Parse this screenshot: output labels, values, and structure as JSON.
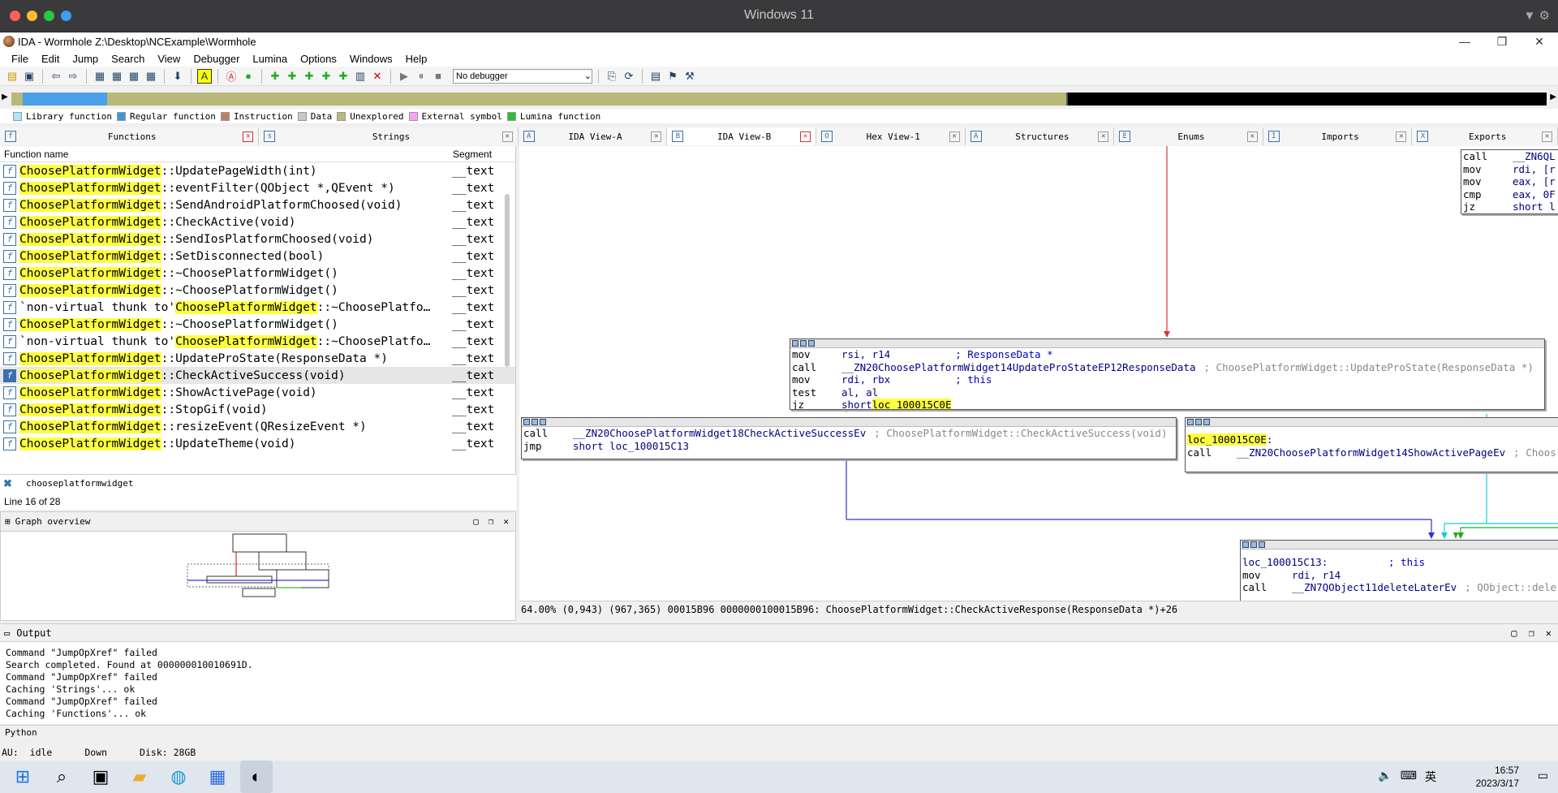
{
  "os_title": "Windows 11",
  "window": {
    "title": "IDA - Wormhole Z:\\Desktop\\NCExample\\Wormhole",
    "min": "—",
    "max": "❐",
    "close": "✕"
  },
  "menu": [
    "File",
    "Edit",
    "Jump",
    "Search",
    "View",
    "Debugger",
    "Lumina",
    "Options",
    "Windows",
    "Help"
  ],
  "debugger_select": "No debugger",
  "legend": [
    {
      "label": "Library function",
      "color": "#a8e8f8"
    },
    {
      "label": "Regular function",
      "color": "#3a9ad9"
    },
    {
      "label": "Instruction",
      "color": "#c08060"
    },
    {
      "label": "Data",
      "color": "#c8c8c8"
    },
    {
      "label": "Unexplored",
      "color": "#b8b878"
    },
    {
      "label": "External symbol",
      "color": "#f8a0f8"
    },
    {
      "label": "Lumina function",
      "color": "#30c030"
    }
  ],
  "tabs": [
    {
      "label": "Functions",
      "icon": "f",
      "close_red": true,
      "active": false
    },
    {
      "label": "Strings",
      "icon": "s",
      "close_red": false,
      "active": false
    },
    {
      "label": "IDA View-A",
      "icon": "A",
      "close_red": false,
      "active": false
    },
    {
      "label": "IDA View-B",
      "icon": "B",
      "close_red": true,
      "active": true
    },
    {
      "label": "Hex View-1",
      "icon": "O",
      "close_red": false,
      "active": false
    },
    {
      "label": "Structures",
      "icon": "A",
      "close_red": false,
      "active": false
    },
    {
      "label": "Enums",
      "icon": "E",
      "close_red": false,
      "active": false
    },
    {
      "label": "Imports",
      "icon": "I",
      "close_red": false,
      "active": false
    },
    {
      "label": "Exports",
      "icon": "X",
      "close_red": false,
      "active": false
    }
  ],
  "functions": {
    "col_name": "Function name",
    "col_segment": "Segment",
    "rows": [
      {
        "pre": "",
        "hl": "ChoosePlatformWidget",
        "post": "::UpdatePageWidth(int)",
        "seg": "__text"
      },
      {
        "pre": "",
        "hl": "ChoosePlatformWidget",
        "post": "::eventFilter(QObject *,QEvent *)",
        "seg": "__text"
      },
      {
        "pre": "",
        "hl": "ChoosePlatformWidget",
        "post": "::SendAndroidPlatformChoosed(void)",
        "seg": "__text"
      },
      {
        "pre": "",
        "hl": "ChoosePlatformWidget",
        "post": "::CheckActive(void)",
        "seg": "__text"
      },
      {
        "pre": "",
        "hl": "ChoosePlatformWidget",
        "post": "::SendIosPlatformChoosed(void)",
        "seg": "__text"
      },
      {
        "pre": "",
        "hl": "ChoosePlatformWidget",
        "post": "::SetDisconnected(bool)",
        "seg": "__text"
      },
      {
        "pre": "",
        "hl": "ChoosePlatformWidget",
        "post": "::~ChoosePlatformWidget()",
        "seg": "__text"
      },
      {
        "pre": "",
        "hl": "ChoosePlatformWidget",
        "post": "::~ChoosePlatformWidget()",
        "seg": "__text"
      },
      {
        "pre": "`non-virtual thunk to'",
        "hl": "ChoosePlatformWidget",
        "post": "::~ChoosePlatfo…",
        "seg": "__text"
      },
      {
        "pre": "",
        "hl": "ChoosePlatformWidget",
        "post": "::~ChoosePlatformWidget()",
        "seg": "__text"
      },
      {
        "pre": "`non-virtual thunk to'",
        "hl": "ChoosePlatformWidget",
        "post": "::~ChoosePlatfo…",
        "seg": "__text"
      },
      {
        "pre": "",
        "hl": "ChoosePlatformWidget",
        "post": "::UpdateProState(ResponseData *)",
        "seg": "__text"
      },
      {
        "pre": "",
        "hl": "ChoosePlatformWidget",
        "post": "::CheckActiveSuccess(void)",
        "seg": "__text",
        "selected": true
      },
      {
        "pre": "",
        "hl": "ChoosePlatformWidget",
        "post": "::ShowActivePage(void)",
        "seg": "__text"
      },
      {
        "pre": "",
        "hl": "ChoosePlatformWidget",
        "post": "::StopGif(void)",
        "seg": "__text"
      },
      {
        "pre": "",
        "hl": "ChoosePlatformWidget",
        "post": "::resizeEvent(QResizeEvent *)",
        "seg": "__text"
      },
      {
        "pre": "",
        "hl": "ChoosePlatformWidget",
        "post": "::UpdateTheme(void)",
        "seg": "__text"
      }
    ]
  },
  "filter": {
    "text": "chooseplatformwidget",
    "line": "Line 16 of 28"
  },
  "graph_overview": {
    "title": "Graph overview"
  },
  "blocks": {
    "top_right": [
      {
        "m": "call",
        "o": "__ZN6QL"
      },
      {
        "m": "mov",
        "o": "rdi, [r"
      },
      {
        "m": "mov",
        "o": "eax, [r"
      },
      {
        "m": "cmp",
        "o": "eax, 0F"
      },
      {
        "m": "jz",
        "o": "short l"
      }
    ],
    "main": [
      {
        "m": "mov",
        "o": "rsi, r14",
        "c": "; ResponseData *"
      },
      {
        "m": "call",
        "o": "__ZN20ChoosePlatformWidget14UpdateProStateEP12ResponseData",
        "g": "; ChoosePlatformWidget::UpdateProState(ResponseData *)"
      },
      {
        "m": "mov",
        "o": "rdi, rbx",
        "c": "; this"
      },
      {
        "m": "test",
        "o": "al, al"
      },
      {
        "m": "jz",
        "o": "short ",
        "hl": "loc_100015C0E"
      }
    ],
    "left": [
      {
        "m": "call",
        "o": "__ZN20ChoosePlatformWidget18CheckActiveSuccessEv",
        "g": "; ChoosePlatformWidget::CheckActiveSuccess(void)"
      },
      {
        "m": "jmp",
        "o": "short loc_100015C13"
      }
    ],
    "right_label": "loc_100015C0E",
    "right": [
      {
        "m": "call",
        "o": "__ZN20ChoosePlatformWidget14ShowActivePageEv",
        "g": "; Choos"
      }
    ],
    "bottom_label": "loc_100015C13:",
    "bottom_label_comment": "; this",
    "bottom": [
      {
        "m": "mov",
        "o": "rdi, r14"
      },
      {
        "m": "call",
        "o": "__ZN7QObject11deleteLaterEv",
        "g": "; QObject::dele"
      }
    ]
  },
  "graph_status": "64.00% (0,943) (967,365) 00015B96 0000000100015B96: ChoosePlatformWidget::CheckActiveResponse(ResponseData *)+26",
  "output": {
    "title": "Output",
    "lines": [
      "Command \"JumpOpXref\" failed",
      "Search completed. Found at 000000010010691D.",
      "Command \"JumpOpXref\" failed",
      "Caching 'Strings'... ok",
      "Command \"JumpOpXref\" failed",
      "Caching 'Functions'... ok"
    ],
    "python": "Python"
  },
  "status": {
    "au": "AU:",
    "state": "idle",
    "dir": "Down",
    "disk": "Disk: 28GB"
  },
  "taskbar": {
    "time": "16:57",
    "date": "2023/3/17",
    "lang": "英"
  }
}
